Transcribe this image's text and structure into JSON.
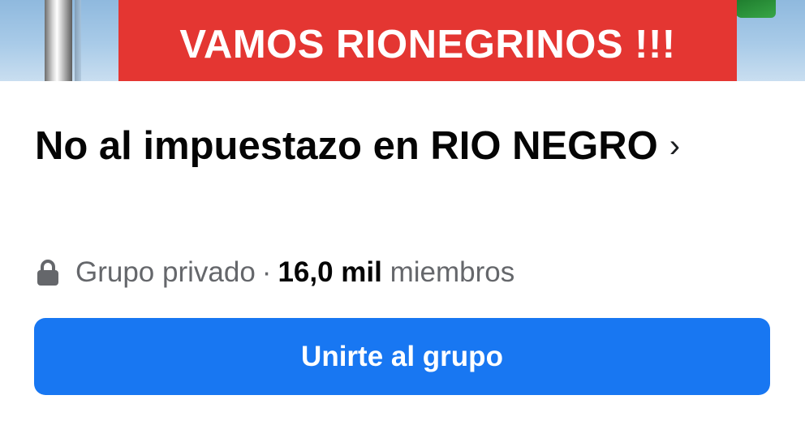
{
  "cover": {
    "banner_text": "VAMOS RIONEGRINOS !!!"
  },
  "group": {
    "name": "No al impuestazo en RIO NEGRO",
    "chevron": "›",
    "privacy": "Grupo privado",
    "separator": "·",
    "member_count": "16,0 mil",
    "members_label": "miembros",
    "icons": {
      "privacy": "lock-icon",
      "open": "chevron-right-icon"
    }
  },
  "actions": {
    "join_label": "Unirte al grupo"
  },
  "colors": {
    "banner": "#e43632",
    "primary_button": "#1877f2",
    "secondary_text": "#65676b"
  }
}
